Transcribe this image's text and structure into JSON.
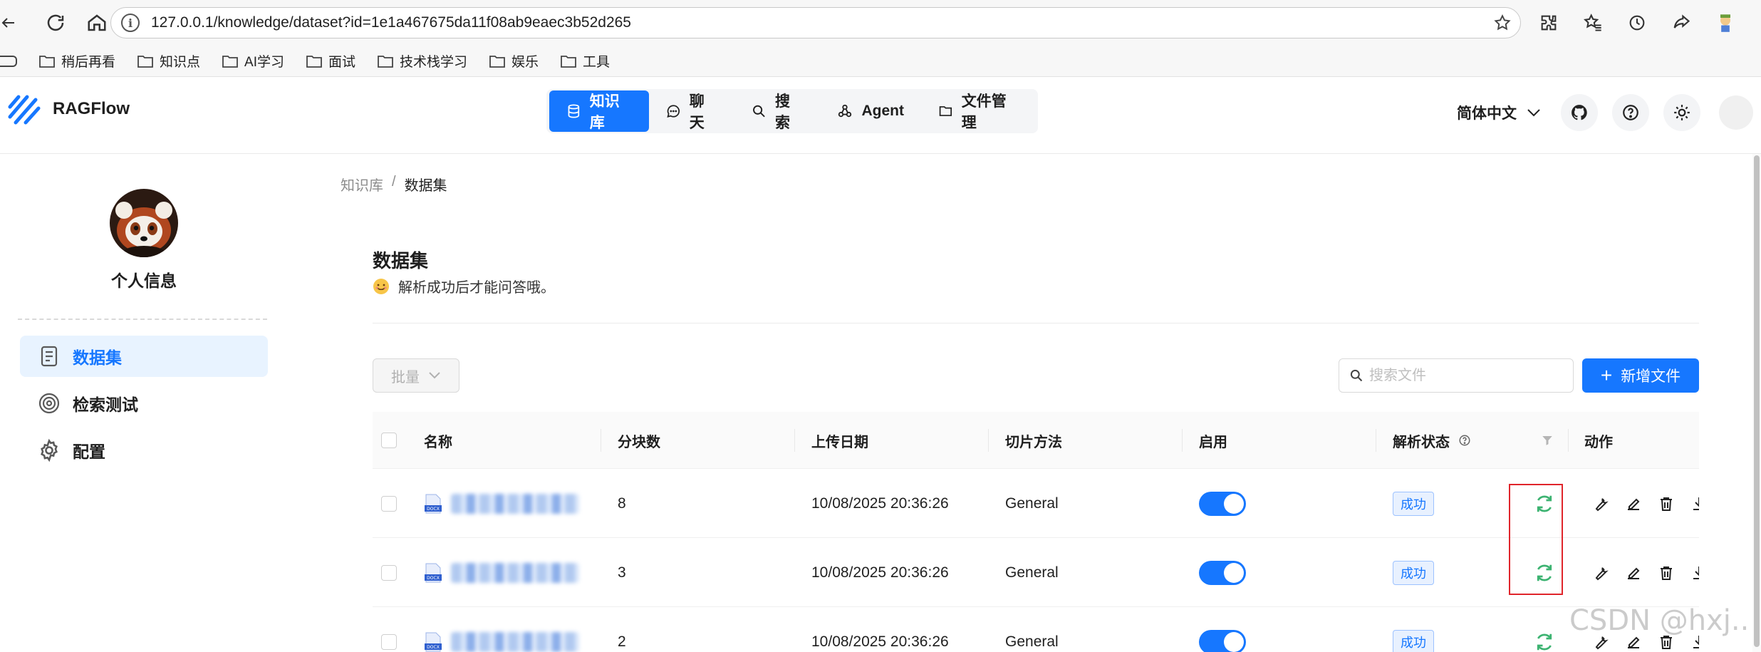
{
  "browser": {
    "url": "127.0.0.1/knowledge/dataset?id=1e1a467675da11f08ab9eaec3b52d265",
    "bookmarks": [
      "稍后再看",
      "知识点",
      "AI学习",
      "面试",
      "技术栈学习",
      "娱乐",
      "工具"
    ]
  },
  "header": {
    "app_name": "RAGFlow",
    "nav": [
      {
        "label": "知识库",
        "icon": "database-icon",
        "active": true
      },
      {
        "label": "聊天",
        "icon": "chat-icon",
        "active": false
      },
      {
        "label": "搜索",
        "icon": "search-icon",
        "active": false
      },
      {
        "label": "Agent",
        "icon": "agent-icon",
        "active": false
      },
      {
        "label": "文件管理",
        "icon": "folder-icon",
        "active": false
      }
    ],
    "language": "简体中文"
  },
  "sidebar": {
    "profile_name": "个人信息",
    "items": [
      {
        "label": "数据集",
        "icon": "document-icon",
        "active": true
      },
      {
        "label": "检索测试",
        "icon": "target-icon",
        "active": false
      },
      {
        "label": "配置",
        "icon": "gear-icon",
        "active": false
      }
    ]
  },
  "breadcrumb": {
    "root": "知识库",
    "separator": "/",
    "current": "数据集"
  },
  "page": {
    "title": "数据集",
    "hint": "解析成功后才能问答哦。",
    "bulk_label": "批量",
    "search_placeholder": "搜索文件",
    "add_file_label": "新增文件"
  },
  "table": {
    "columns": [
      "名称",
      "分块数",
      "上传日期",
      "切片方法",
      "启用",
      "解析状态",
      "动作"
    ],
    "rows": [
      {
        "chunks": "8",
        "upload_date": "10/08/2025 20:36:26",
        "method": "General",
        "enabled": true,
        "status": "成功"
      },
      {
        "chunks": "3",
        "upload_date": "10/08/2025 20:36:26",
        "method": "General",
        "enabled": true,
        "status": "成功"
      },
      {
        "chunks": "2",
        "upload_date": "10/08/2025 20:36:26",
        "method": "General",
        "enabled": true,
        "status": "成功"
      }
    ]
  },
  "watermark": "CSDN @hxj..",
  "colors": {
    "accent": "#1677ff",
    "success": "#3cb371",
    "highlight": "#e0252b"
  }
}
